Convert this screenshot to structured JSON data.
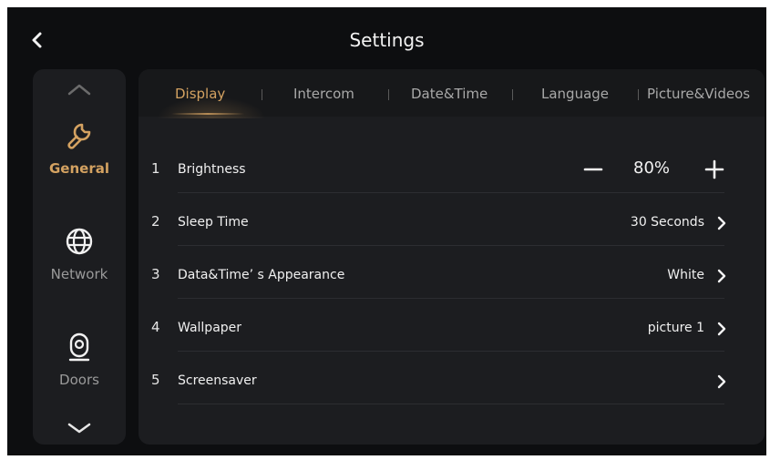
{
  "header": {
    "title": "Settings",
    "back_icon": "chevron-left-icon"
  },
  "sidebar": {
    "items": [
      {
        "label": "General",
        "icon": "wrench-icon",
        "active": true
      },
      {
        "label": "Network",
        "icon": "globe-icon",
        "active": false
      },
      {
        "label": "Doors",
        "icon": "door-camera-icon",
        "active": false
      }
    ]
  },
  "tabs": [
    {
      "label": "Display",
      "active": true
    },
    {
      "label": "Intercom",
      "active": false
    },
    {
      "label": "Date&Time",
      "active": false
    },
    {
      "label": "Language",
      "active": false
    },
    {
      "label": "Picture&Videos",
      "active": false
    }
  ],
  "rows": [
    {
      "num": "1",
      "label": "Brightness",
      "value": "80%"
    },
    {
      "num": "2",
      "label": "Sleep Time",
      "value": "30 Seconds"
    },
    {
      "num": "3",
      "label": "Data&Time’ s Appearance",
      "value": "White"
    },
    {
      "num": "4",
      "label": "Wallpaper",
      "value": "picture 1"
    },
    {
      "num": "5",
      "label": "Screensaver",
      "value": ""
    }
  ],
  "colors": {
    "accent": "#d4a261",
    "background": "#0d0e10",
    "panel": "#1c1d20"
  }
}
